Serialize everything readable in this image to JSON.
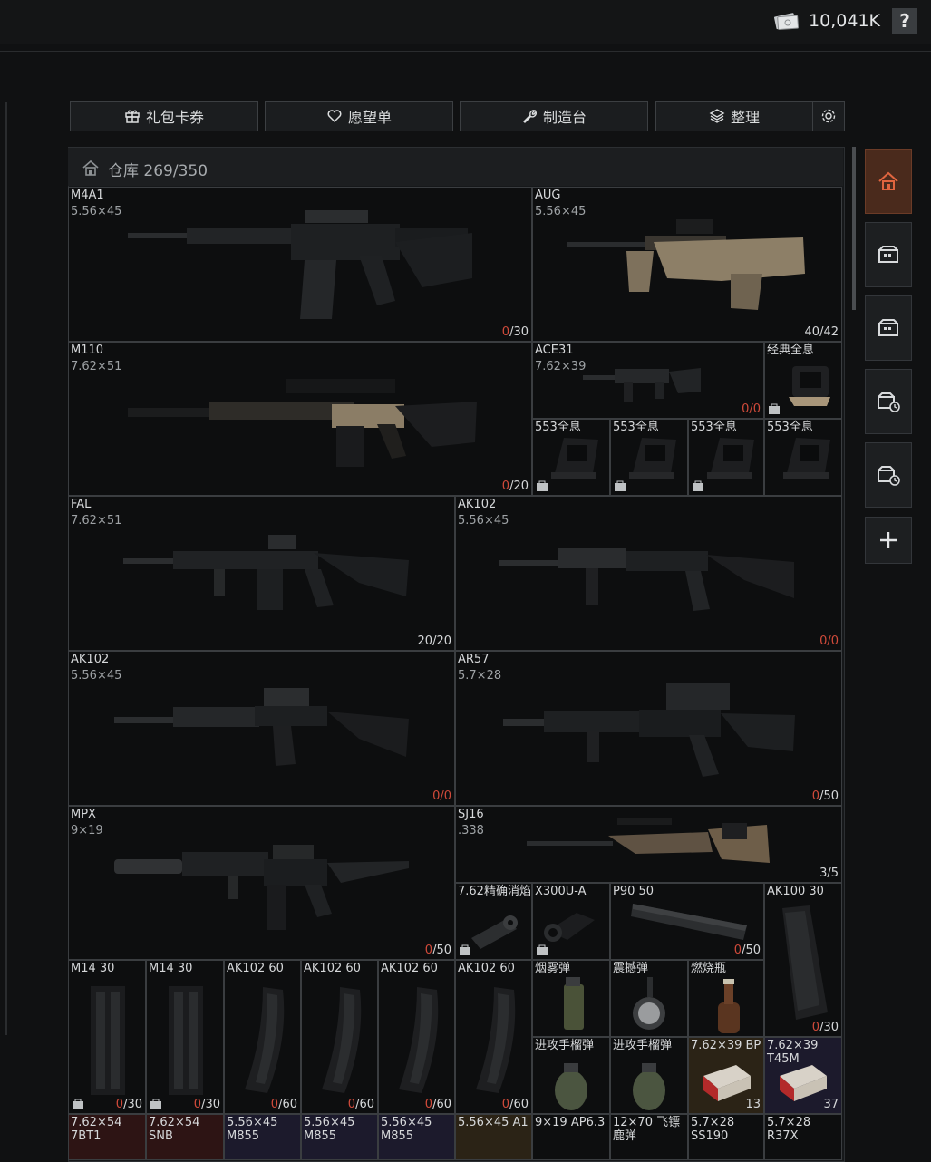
{
  "header": {
    "money": "10,041K",
    "help": "?"
  },
  "tabs": [
    {
      "label": "礼包卡券",
      "icon": "gift-icon"
    },
    {
      "label": "愿望单",
      "icon": "heart-icon"
    },
    {
      "label": "制造台",
      "icon": "wrench-icon"
    },
    {
      "label": "整理",
      "icon": "layers-icon"
    }
  ],
  "warehouse": {
    "label": "仓库 269/350"
  },
  "items": {
    "m4a1": {
      "name": "M4A1",
      "cal": "5.56×45",
      "ammo": "0",
      "cap": "/30"
    },
    "aug": {
      "name": "AUG",
      "cal": "5.56×45",
      "count": "40/42"
    },
    "m110": {
      "name": "M110",
      "cal": "7.62×51",
      "ammo": "0",
      "cap": "/20"
    },
    "ace31": {
      "name": "ACE31",
      "cal": "7.62×39",
      "count": "0/0"
    },
    "holo1": {
      "name": "经典全息"
    },
    "h553a": {
      "name": "553全息"
    },
    "h553b": {
      "name": "553全息"
    },
    "h553c": {
      "name": "553全息"
    },
    "h553d": {
      "name": "553全息"
    },
    "fal": {
      "name": "FAL",
      "cal": "7.62×51",
      "count": "20/20"
    },
    "ak102a": {
      "name": "AK102",
      "cal": "5.56×45",
      "count": "0/0"
    },
    "ak102b": {
      "name": "AK102",
      "cal": "5.56×45",
      "count": "0/0"
    },
    "ar57": {
      "name": "AR57",
      "cal": "5.7×28",
      "ammo": "0",
      "cap": "/50"
    },
    "mpx": {
      "name": "MPX",
      "cal": "9×19",
      "ammo": "0",
      "cap": "/50"
    },
    "sj16": {
      "name": "SJ16",
      "cal": ".338",
      "count": "3/5"
    },
    "muzzle": {
      "name": "7.62精确消焰"
    },
    "x300": {
      "name": "X300U-A"
    },
    "p90mag": {
      "name": "P90 50",
      "ammo": "0",
      "cap": "/50"
    },
    "ak100mag": {
      "name": "AK100 30",
      "ammo": "0",
      "cap": "/30"
    },
    "m14a": {
      "name": "M14 30",
      "ammo": "0",
      "cap": "/30"
    },
    "m14b": {
      "name": "M14 30",
      "ammo": "0",
      "cap": "/30"
    },
    "ak60a": {
      "name": "AK102 60",
      "ammo": "0",
      "cap": "/60"
    },
    "ak60b": {
      "name": "AK102 60",
      "ammo": "0",
      "cap": "/60"
    },
    "ak60c": {
      "name": "AK102 60",
      "ammo": "0",
      "cap": "/60"
    },
    "ak60d": {
      "name": "AK102 60",
      "ammo": "0",
      "cap": "/60"
    },
    "smoke": {
      "name": "烟雾弹"
    },
    "stun": {
      "name": "震撼弹"
    },
    "molotov": {
      "name": "燃烧瓶"
    },
    "frag1": {
      "name": "进攻手榴弹"
    },
    "frag2": {
      "name": "进攻手榴弹"
    },
    "bp": {
      "name": "7.62×39 BP",
      "count": "13"
    },
    "t45": {
      "name": "7.62×39 T45M",
      "count": "37"
    },
    "r1": {
      "name": "7.62×54 7BT1"
    },
    "r2": {
      "name": "7.62×54 SNB"
    },
    "r3": {
      "name": "5.56×45 M855"
    },
    "r4": {
      "name": "5.56×45 M855"
    },
    "r5": {
      "name": "5.56×45 M855"
    },
    "r6": {
      "name": "5.56×45 A1"
    },
    "r7": {
      "name": "9×19 AP6.3"
    },
    "r8": {
      "name": "12×70 飞镖鹿弹"
    },
    "r9": {
      "name": "5.7×28 SS190"
    },
    "r10": {
      "name": "5.7×28 R37X"
    }
  },
  "sidebar": [
    {
      "icon": "warehouse-icon",
      "active": true
    },
    {
      "icon": "storage-icon"
    },
    {
      "icon": "storage-icon"
    },
    {
      "icon": "storage-timer-icon"
    },
    {
      "icon": "storage-timer-icon"
    },
    {
      "icon": "plus-icon"
    }
  ],
  "colors": {
    "accent": "#d04a3a",
    "active_tab": "#4a2a1c",
    "ammo_purple": "#1c1a2c",
    "ammo_brown": "#2b2316"
  }
}
